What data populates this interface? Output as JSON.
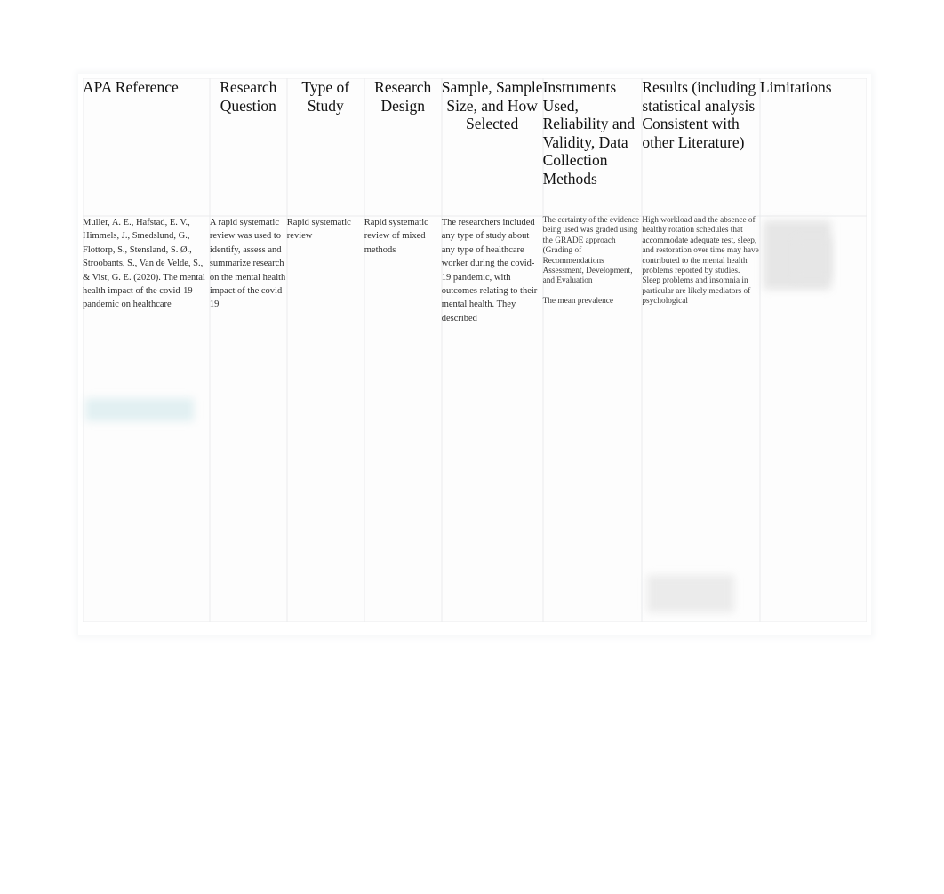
{
  "document": {
    "type": "research-literature-matrix",
    "background_color": "#ffffff",
    "table_border_color": "#e6e8ea"
  },
  "table": {
    "name": "literature-review-matrix",
    "headers": [
      {
        "id": "apa-reference",
        "label": "APA Reference",
        "align": "left"
      },
      {
        "id": "research-question",
        "label": "Research Question",
        "align": "center"
      },
      {
        "id": "type-of-study",
        "label": "Type of Study",
        "align": "center"
      },
      {
        "id": "research-design",
        "label": "Research Design",
        "align": "center"
      },
      {
        "id": "sample-size-selection",
        "label": "Sample, Sample Size, and How Selected",
        "align": "center"
      },
      {
        "id": "instruments-used",
        "label": "Instruments Used, Reliability and Validity, Data Collection Methods",
        "align": "left"
      },
      {
        "id": "results",
        "label": "Results (including statistical analysis Consistent with other Literature)",
        "align": "left"
      },
      {
        "id": "limitations",
        "label": "Limitations",
        "align": "left"
      }
    ],
    "rows": [
      {
        "id": "row-muller-2020",
        "cells": {
          "apa_reference": "Muller, A. E., Hafstad, E. V., Himmels, J., Smedslund, G., Flottorp, S., Stensland, S. Ø., Stroobants, S., Van de Velde, S., & Vist, G. E. (2020). The mental health impact of the covid-19 pandemic on healthcare",
          "research_question": "A rapid systematic review was used to identify, assess and summarize research on the mental health impact of the covid-19",
          "type_of_study": "Rapid systematic review",
          "research_design": "Rapid systematic review of mixed methods",
          "sample": "The researchers included any type of study about any type of healthcare worker during the covid-19 pandemic, with outcomes relating to their mental health. They described",
          "instruments_primary": "The certainty of the evidence being used was graded using the GRADE approach (Grading of Recommendations Assessment, Development, and Evaluation",
          "instruments_secondary": "The mean prevalence",
          "results": "High workload and the absence of healthy rotation schedules that accommodate adequate rest, sleep, and restoration over time may have contributed to the mental health problems reported by studies. Sleep problems and insomnia in particular are likely mediators of psychological",
          "limitations": ""
        }
      }
    ]
  },
  "redactions": [
    {
      "id": "limitations-redaction-block",
      "column": "limitations",
      "color": "#e6e6e6"
    },
    {
      "id": "apa-reference-highlight-block",
      "column": "apa-reference",
      "color": "#e2f0f2"
    },
    {
      "id": "results-redaction-block",
      "column": "results",
      "color": "#ebebeb"
    }
  ]
}
